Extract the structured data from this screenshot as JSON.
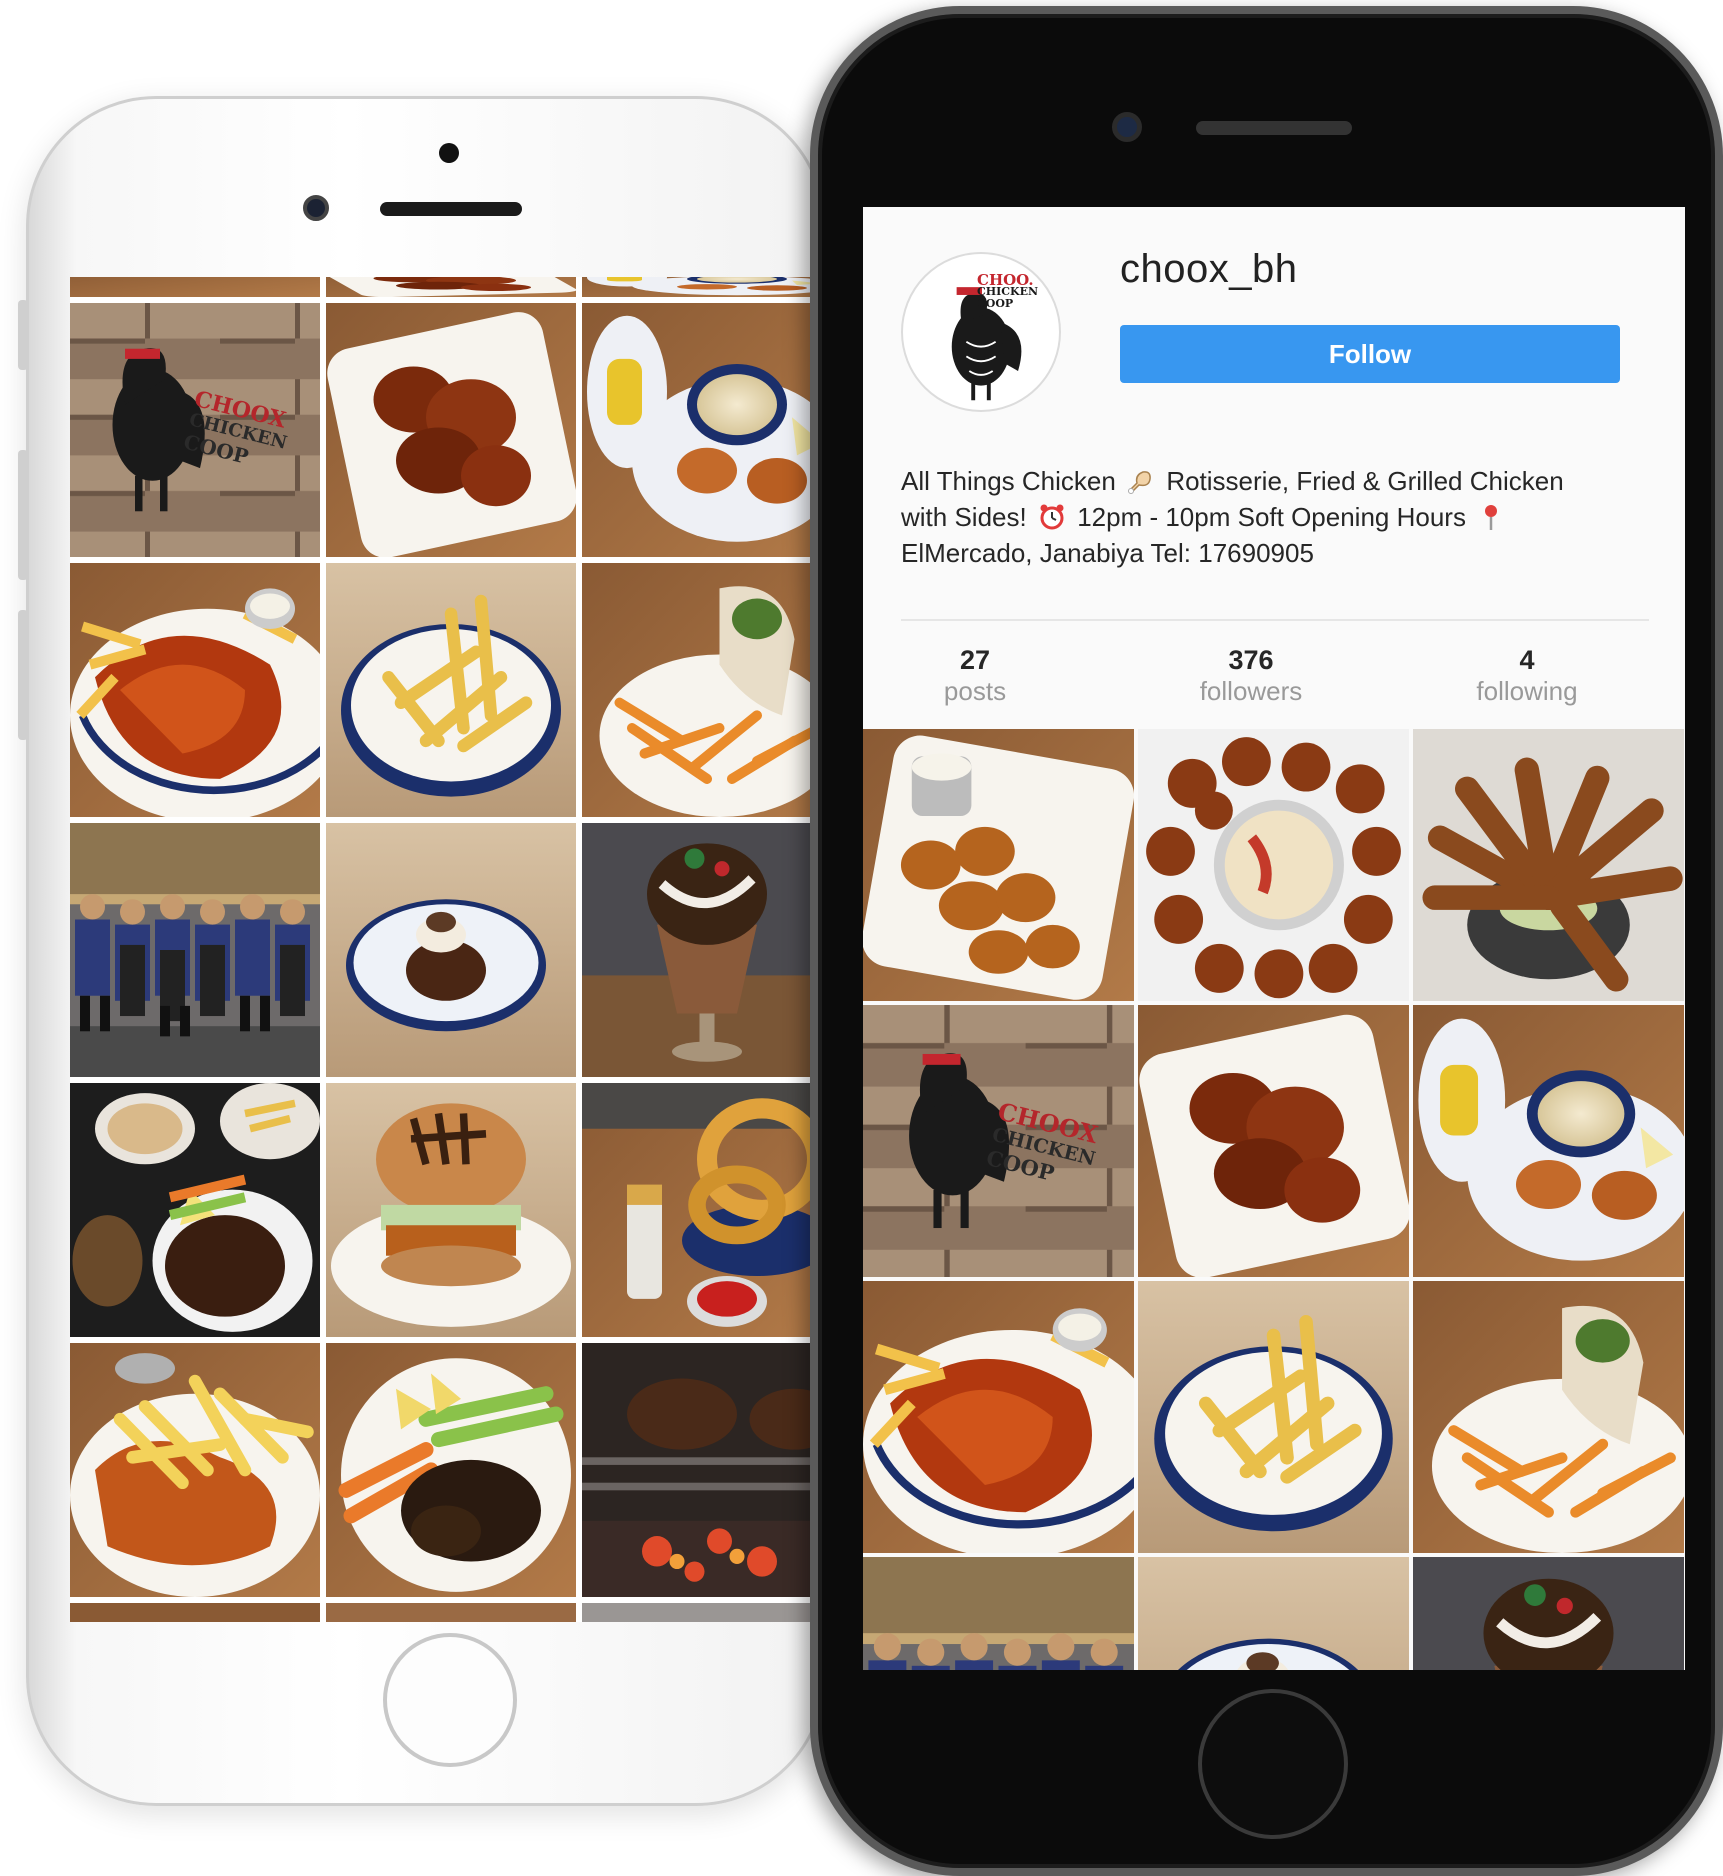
{
  "profile": {
    "username": "choox_bh",
    "follow_label": "Follow",
    "bio_line1_a": "All Things Chicken",
    "bio_line1_b": "Rotisserie, Fried & Grilled Chicken",
    "bio_line2_a": "with Sides!",
    "bio_line2_b": "12pm - 10pm Soft Opening Hours",
    "bio_line3": "ElMercado, Janabiya Tel: 17690905",
    "avatar_text_1": "CHOO.",
    "avatar_text_2": "CHICKEN",
    "avatar_text_3": "COOP",
    "stats": [
      {
        "value": "27",
        "label": "posts"
      },
      {
        "value": "376",
        "label": "followers"
      },
      {
        "value": "4",
        "label": "following"
      }
    ]
  },
  "wall_sign": {
    "line1": "CHOOX",
    "line2": "CHICKEN",
    "line3": "COOP"
  },
  "colors": {
    "follow_button": "#3897f0",
    "phone_front": "#0b0b0b",
    "phone_back": "#f5f5f5"
  },
  "icons": {
    "bio_emoji_1": "chicken-leg-icon",
    "bio_emoji_2": "alarm-clock-icon",
    "bio_emoji_3": "location-pin-icon"
  }
}
